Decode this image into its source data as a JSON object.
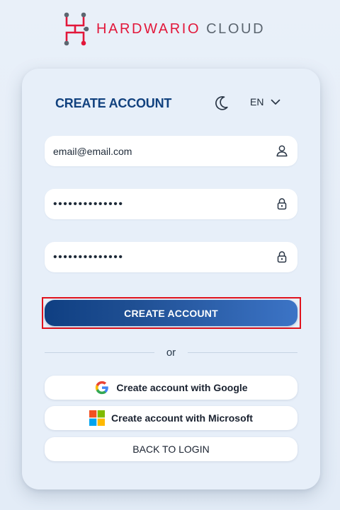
{
  "logo": {
    "brand": "HARDWARIO",
    "product": "CLOUD"
  },
  "header": {
    "title": "CREATE ACCOUNT",
    "theme_icon": "moon-icon",
    "language": "EN",
    "language_icon": "chevron-down-icon"
  },
  "form": {
    "email_value": "email@email.com",
    "email_icon": "user-icon",
    "password_value": "••••••••••••••",
    "password_icon": "lock-icon",
    "confirm_password_value": "••••••••••••••",
    "confirm_password_icon": "lock-icon"
  },
  "actions": {
    "create_account_label": "CREATE ACCOUNT",
    "divider_text": "or",
    "google_label": "Create account with Google",
    "google_icon": "google-icon",
    "microsoft_label": "Create account with Microsoft",
    "microsoft_icon": "microsoft-icon",
    "back_label": "BACK TO LOGIN"
  },
  "colors": {
    "brand_red": "#e2173a",
    "title_blue": "#11417e",
    "button_gradient_start": "#0f3f82",
    "button_gradient_end": "#3c74c6",
    "highlight_border": "#e0121c"
  }
}
